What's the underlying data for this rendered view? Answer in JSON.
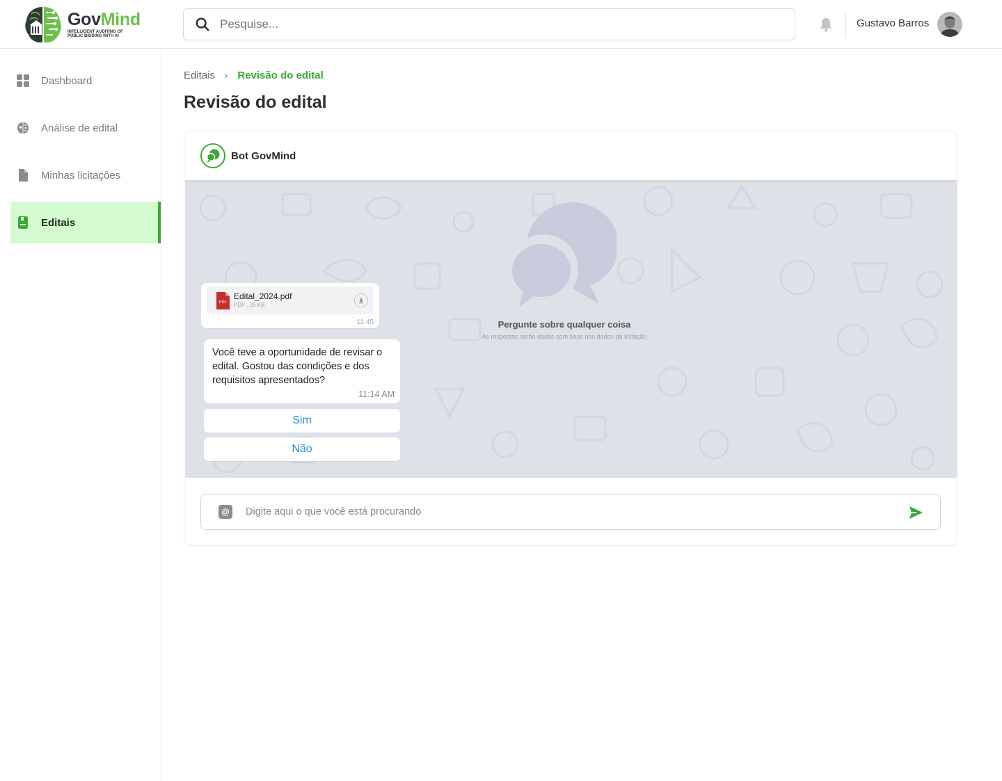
{
  "header": {
    "logo": {
      "name_part1": "Gov",
      "name_part2": "Mind",
      "tagline": "INTELLIGENT AUDITING OF PUBLIC BIDDING WITH AI"
    },
    "search": {
      "placeholder": "Pesquise..."
    },
    "user": {
      "name": "Gustavo Barros"
    }
  },
  "sidebar": {
    "items": [
      {
        "label": "Dashboard",
        "icon": "grid-icon",
        "active": false
      },
      {
        "label": "Análise de edital",
        "icon": "brain-icon",
        "active": false
      },
      {
        "label": "Minhas licitações",
        "icon": "document-icon",
        "active": false
      },
      {
        "label": "Editais",
        "icon": "book-icon",
        "active": true
      }
    ]
  },
  "breadcrumb": {
    "parent": "Editais",
    "separator": "›",
    "current": "Revisão do edital"
  },
  "page": {
    "title": "Revisão do edital"
  },
  "chat": {
    "bot_name": "Bot GovMind",
    "empty_title": "Pergunte sobre qualquer coisa",
    "empty_subtitle": "As respostas serão dadas com base nos dados da licitação",
    "file": {
      "name": "Edital_2024.pdf",
      "info": "PDF . 25 KB",
      "time": "11:45",
      "icon_label": "PDF"
    },
    "message": {
      "text": "Você teve a oportunidade de revisar o edital. Gostou das condições e dos requisitos apresentados?",
      "time": "11:14 AM"
    },
    "replies": [
      "Sim",
      "Não"
    ],
    "input": {
      "placeholder": "Digite aqui o que você está procurando",
      "attach_icon_label": "@"
    }
  },
  "colors": {
    "brand_green": "#3aa935",
    "logo_green": "#6cc04a",
    "active_bg": "#d4fad0",
    "chat_bg": "#dfe1e8",
    "reply_blue": "#2a8fcf"
  }
}
